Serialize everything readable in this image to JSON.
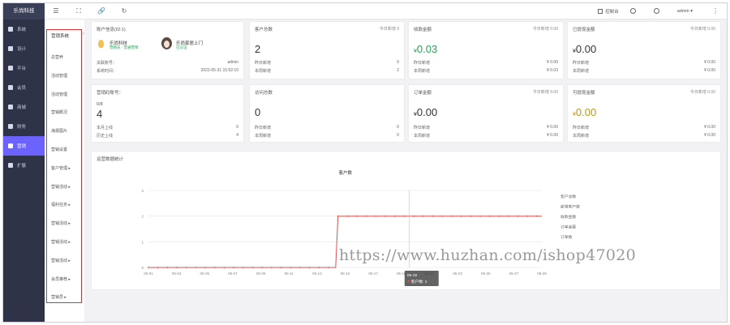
{
  "rail": {
    "brand": "乐尚科技",
    "items": [
      {
        "label": "系统",
        "icon": "home-icon",
        "active": false
      },
      {
        "label": "设计",
        "icon": "design-icon",
        "active": false
      },
      {
        "label": "平台",
        "icon": "grid-icon",
        "active": false
      },
      {
        "label": "会员",
        "icon": "heart-icon",
        "active": false
      },
      {
        "label": "商城",
        "icon": "shop-icon",
        "active": false
      },
      {
        "label": "财务",
        "icon": "wallet-icon",
        "active": false
      },
      {
        "label": "营销",
        "icon": "marketing-icon",
        "active": true
      },
      {
        "label": "扩展",
        "icon": "extend-icon",
        "active": false
      }
    ]
  },
  "topbar": {
    "console": "控制台",
    "user": "admin ▾"
  },
  "subnav": {
    "title": "营销系统",
    "items": [
      "总营养",
      "活动管理",
      "活动管理",
      "营销概况",
      "海报图片",
      "营销设置",
      "客户管理 ▸",
      "营销活动 ▸",
      "福利任务 ▸",
      "营销活动 ▸",
      "营销活动 ▸",
      "营销活动 ▸",
      "会员推荐 ▸",
      "营销员 ▸"
    ]
  },
  "cards": {
    "account": {
      "title": "账户信息(ID:1)",
      "brand_name": "乐尚科技",
      "brand_sub": "营销员 · 普通营销",
      "user_name": "乐尚家居上门",
      "user_sub": "已认证",
      "rows": [
        {
          "label": "关联账号：",
          "value": "admin"
        },
        {
          "label": "系统时间：",
          "value": "2022-05-31 15:52:10"
        }
      ]
    },
    "customers": {
      "title": "客户总数",
      "right": "今日新增 0",
      "value": "2",
      "rows": [
        {
          "label": "昨日新增",
          "value": "0"
        },
        {
          "label": "本周新增",
          "value": "2"
        }
      ]
    },
    "income": {
      "title": "收款金额",
      "right": "今日新增 0.00",
      "currency": "¥",
      "value": "0.03",
      "rows": [
        {
          "label": "昨日新增",
          "value": "¥ 0.00"
        },
        {
          "label": "本周新增",
          "value": "¥ 0.03"
        }
      ]
    },
    "withdraw": {
      "title": "已提现金额",
      "right": "今日新增 0.00",
      "currency": "¥",
      "value": "0.00",
      "rows": [
        {
          "label": "昨日新增",
          "value": "¥ 0.00"
        },
        {
          "label": "本周新增",
          "value": "¥ 0.00"
        }
      ]
    },
    "codes": {
      "title": "营销码账号：",
      "sub": "0/8",
      "value": "4",
      "rows": [
        {
          "label": "本月上线",
          "value": "0"
        },
        {
          "label": "历史上线",
          "value": "4"
        }
      ]
    },
    "views": {
      "title": "访问总数",
      "right": "",
      "value": "0",
      "rows": [
        {
          "label": "昨日新增",
          "value": "0"
        },
        {
          "label": "本周新增",
          "value": "0"
        }
      ]
    },
    "orders": {
      "title": "订单金额",
      "right": "今日新增 0.00",
      "currency": "¥",
      "value": "0.00",
      "rows": [
        {
          "label": "昨日新增",
          "value": "¥ 0.00"
        },
        {
          "label": "本周新增",
          "value": "¥ 0.00"
        }
      ]
    },
    "reward": {
      "title": "可提现金额",
      "right": "今日新增 0.00",
      "currency": "¥",
      "value": "0.00",
      "rows": [
        {
          "label": "昨日新增",
          "value": "¥ 0.00"
        },
        {
          "label": "本周新增",
          "value": "¥ 0.00"
        }
      ]
    }
  },
  "chart_panel_title": "运营数据统计",
  "chart_data": {
    "type": "line",
    "title": "客户数",
    "categories": [
      "05-01",
      "05-03",
      "05-05",
      "05-07",
      "05-09",
      "05-11",
      "05-13",
      "05-15",
      "05-17",
      "05-19",
      "05-21",
      "05-23",
      "05-25",
      "05-27",
      "05-29"
    ],
    "series": [
      {
        "name": "客户数",
        "color": "#d9534f",
        "values": [
          0,
          0,
          0,
          0,
          0,
          0,
          0,
          0,
          0,
          0,
          0,
          0,
          0,
          0,
          0,
          0,
          0,
          0,
          0,
          0,
          0,
          0,
          0,
          0,
          0,
          0,
          0,
          0,
          0,
          0,
          0,
          0,
          0,
          0,
          0,
          0,
          0,
          0,
          0,
          0,
          0,
          0,
          0,
          0,
          0,
          0,
          0,
          0,
          0,
          0,
          0,
          0,
          0,
          0,
          0,
          0,
          0,
          0,
          0,
          0,
          0,
          0,
          0,
          0,
          0,
          0,
          0,
          0,
          0,
          0,
          0,
          0,
          0,
          0,
          0,
          0,
          0,
          0,
          0,
          0,
          2,
          2,
          2,
          2,
          2,
          2,
          2,
          2,
          2,
          2,
          2,
          2,
          2,
          2,
          2,
          2,
          2,
          2,
          2,
          2,
          2,
          2,
          2,
          2,
          2,
          2,
          2,
          2,
          2,
          2,
          2,
          2,
          2,
          2,
          2,
          2,
          2,
          2,
          2,
          2,
          2,
          2,
          2,
          2,
          2,
          2,
          2,
          2,
          2,
          2,
          2,
          2,
          2,
          2,
          2,
          2,
          2,
          2,
          2,
          2,
          2,
          2,
          2,
          2,
          2,
          2,
          2,
          2,
          2,
          2,
          2,
          2,
          2,
          2,
          2,
          2,
          2,
          2,
          2,
          2,
          2,
          2,
          2,
          2,
          2,
          2,
          2
        ]
      }
    ],
    "legend": [
      "客户总数",
      "新增客户数",
      "收款金额",
      "订单金额",
      "订单数"
    ],
    "yticks": [
      "0",
      "1",
      "2",
      "3"
    ],
    "ylim": [
      0,
      3
    ],
    "tooltip": {
      "title": "05-19",
      "label": "客户数: 2"
    },
    "grid": true,
    "legend_position": "right"
  },
  "watermark": "https://www.huzhan.com/ishop47020"
}
